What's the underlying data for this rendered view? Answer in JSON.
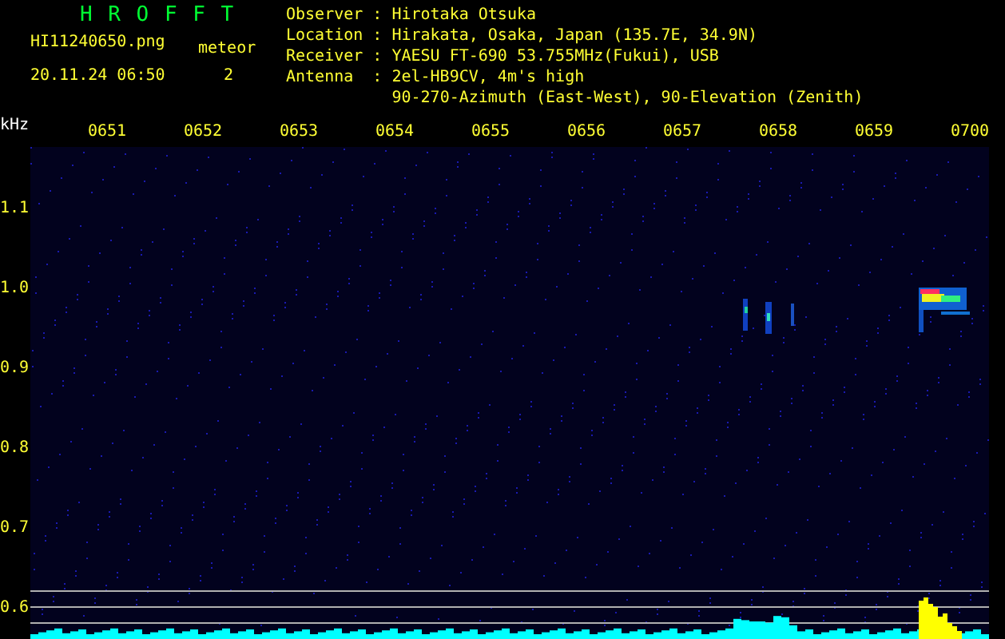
{
  "app_title": "H R O F F T",
  "file_name": "HI11240650.png",
  "date_time": "20.11.24 06:50",
  "detection": {
    "label": "meteor",
    "count": "2"
  },
  "station_info": [
    {
      "label": "Observer",
      "separator": ":",
      "value": "Hirotaka Otsuka"
    },
    {
      "label": "Location",
      "separator": ":",
      "value": "Hirakata, Osaka, Japan (135.7E, 34.9N)"
    },
    {
      "label": "Receiver",
      "separator": ":",
      "value": "YAESU FT-690 53.755MHz(Fukui), USB"
    },
    {
      "label": "Antenna",
      "separator": ":",
      "value": "2el-HB9CV, 4m's high"
    },
    {
      "value": "90-270-Azimuth (East-West), 90-Elevation (Zenith)"
    }
  ],
  "y_unit": "kHz",
  "time_labels": [
    "0651",
    "0652",
    "0653",
    "0654",
    "0655",
    "0656",
    "0657",
    "0658",
    "0659",
    "0700"
  ],
  "frequency_labels": [
    "1.1",
    "1.0",
    "0.9",
    "0.8",
    "0.7",
    "0.6"
  ]
}
